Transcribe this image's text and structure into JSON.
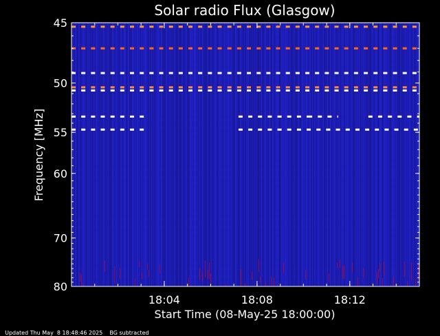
{
  "chart_data": {
    "type": "heatmap",
    "title": "Solar radio Flux (Glasgow)",
    "xlabel": "Start Time (08-May-25 18:00:00)",
    "ylabel": "Frequency [MHz]",
    "x_unit": "minutes after 18:00",
    "xlim": [
      0,
      15
    ],
    "ylim": [
      45,
      80
    ],
    "y_scale": "reciprocal",
    "x_ticks": [
      {
        "value": 4,
        "label": "18:04"
      },
      {
        "value": 8,
        "label": "18:08"
      },
      {
        "value": 12,
        "label": "18:12"
      }
    ],
    "y_ticks": [
      {
        "value": 45,
        "label": "45"
      },
      {
        "value": 50,
        "label": "50"
      },
      {
        "value": 55,
        "label": "55"
      },
      {
        "value": 60,
        "label": "60"
      },
      {
        "value": 70,
        "label": "70"
      },
      {
        "value": 80,
        "label": "80"
      }
    ],
    "background_color": "#1a1ab4",
    "interference_bands": [
      {
        "freq": 45.3,
        "color": "#ff9933",
        "active": [
          [
            0,
            15
          ]
        ]
      },
      {
        "freq": 47.0,
        "color": "#ff6622",
        "active": [
          [
            0,
            15
          ]
        ]
      },
      {
        "freq": 49.1,
        "color": "#ffffff",
        "active": [
          [
            0,
            15
          ]
        ]
      },
      {
        "freq": 50.4,
        "color": "#ff8844",
        "active": [
          [
            0,
            15
          ]
        ]
      },
      {
        "freq": 50.7,
        "color": "#ffffff",
        "active": [
          [
            0,
            15
          ]
        ]
      },
      {
        "freq": 53.3,
        "color": "#ffffff",
        "active": [
          [
            0,
            3.2
          ],
          [
            7.2,
            10.2
          ],
          [
            10.2,
            11.5
          ],
          [
            12.8,
            15
          ]
        ]
      },
      {
        "freq": 54.7,
        "color": "#ffffff",
        "active": [
          [
            0,
            3.2
          ],
          [
            7.2,
            15
          ]
        ]
      }
    ]
  },
  "footer": {
    "updated": "Updated Thu May  8 18:48:46 2025",
    "note": "BG subtracted"
  }
}
